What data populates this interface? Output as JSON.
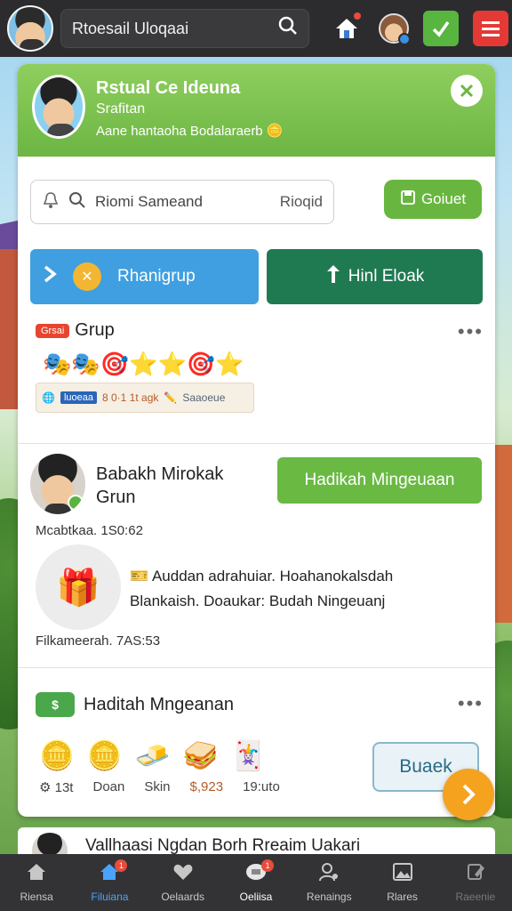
{
  "topbar": {
    "search_text": "Rtoesail Uloqaai",
    "icons": [
      "avatar",
      "search-icon",
      "home-icon",
      "profile-badge-icon",
      "check-icon",
      "menu-icon"
    ]
  },
  "profile_card": {
    "name": "Rstual Ce Ideuna",
    "subtitle": "Srafitan",
    "description": "Aane hantaoha Bodalaraerb"
  },
  "search": {
    "placeholder": "Riomi Sameand",
    "right_label": "Rioqid"
  },
  "buttons": {
    "send": "Goiuet",
    "blue_action": "Rhanigrup",
    "teal_action": "Hinl Eloak"
  },
  "grup": {
    "tag": "Grsai",
    "title": "Grup",
    "emojis": "🎭🎭🎯⭐⭐🎯⭐",
    "strip_blue": "luoeaa",
    "strip_main": "8 0·1 1t agk",
    "strip_gray": "Saaoeue"
  },
  "post": {
    "name_line1": "Babakh Mirokak",
    "name_line2": "Grun",
    "action_button": "Hadikah Mingeuaan",
    "meta": "Mcabtkaa. 1S0:62",
    "gift_emoji": "🎁",
    "text_line1": "Auddan adrahuiar. Hoahanokalsdah",
    "text_line2": "Blankaish. Doaukar: Budah Ningeuanj",
    "time": "Filkameerah. 7AS:53"
  },
  "hadiah": {
    "badge": "$",
    "title": "Haditah Mngeanan",
    "items_emoji": [
      "🪙",
      "🪙",
      "🧈",
      "🥪",
      "🃏"
    ],
    "labels": [
      "13t",
      "Doan",
      "Skin",
      "$,923",
      "19:uto"
    ],
    "open_button": "Buaek"
  },
  "peek": {
    "text": "Vallhaasi Ngdan Borh Rreaim Uakari"
  },
  "bottom_nav": [
    {
      "label": "Riensa",
      "icon": "home-icon"
    },
    {
      "label": "Filuiana",
      "icon": "home-active-icon",
      "badge": "1",
      "active": true
    },
    {
      "label": "Oelaards",
      "icon": "heart-icon"
    },
    {
      "label": "Oeliisa",
      "icon": "chat-icon",
      "badge": "1"
    },
    {
      "label": "Renaings",
      "icon": "people-icon"
    },
    {
      "label": "Rlares",
      "icon": "gallery-icon"
    },
    {
      "label": "Raeenie",
      "icon": "edit-icon",
      "disabled": true
    }
  ],
  "colors": {
    "accent_green": "#6cb643",
    "accent_blue": "#3f9fe0",
    "accent_teal": "#1f7a52",
    "fab_orange": "#f5a21f"
  }
}
